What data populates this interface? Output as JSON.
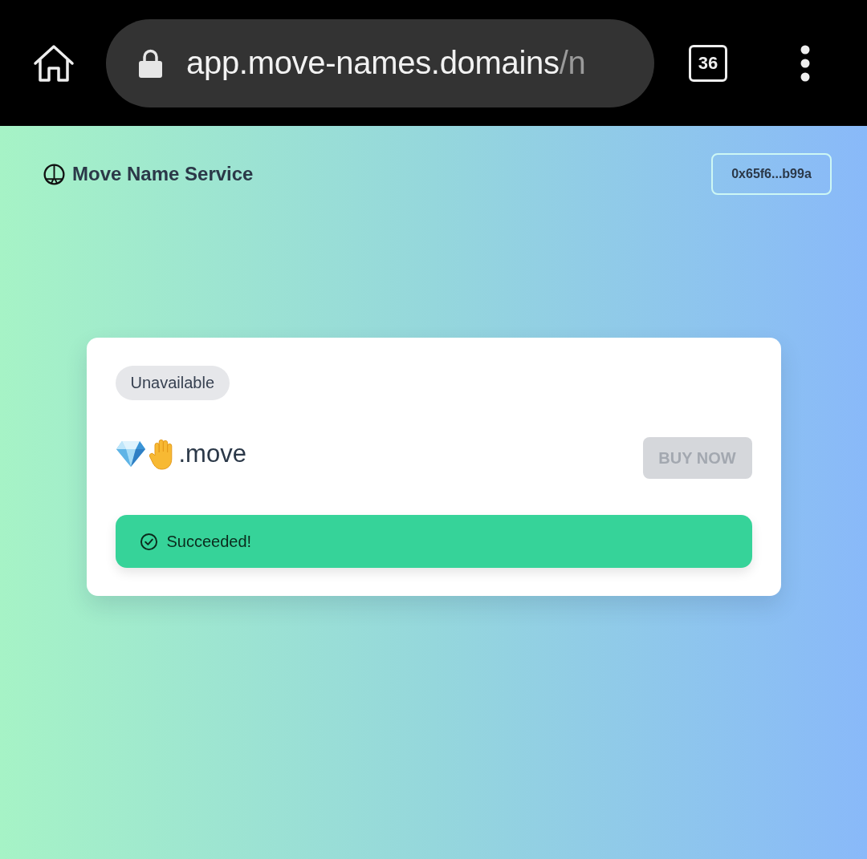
{
  "browser_bar": {
    "url": {
      "host": "app.move-names.domains",
      "path": "/n"
    },
    "tab_count": "36"
  },
  "header": {
    "title": "Move Name Service",
    "wallet_address": "0x65f6...b99a"
  },
  "card": {
    "badge": {
      "label": "Unavailable",
      "kind": "unavailable"
    },
    "domain": {
      "name": ".move"
    },
    "buy_button": {
      "label": "BUY NOW",
      "disabled": true
    },
    "alert": {
      "kind": "success",
      "message": "Succeeded!"
    }
  }
}
